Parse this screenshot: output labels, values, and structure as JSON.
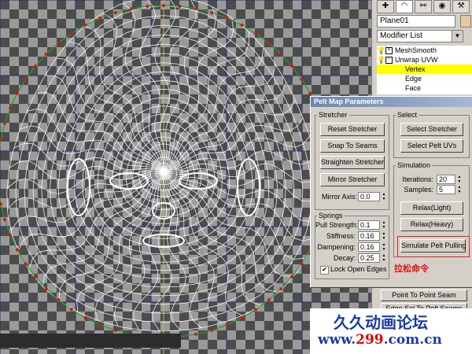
{
  "command_panel": {
    "tabs": [
      "",
      "",
      "",
      "",
      ""
    ],
    "object_name": "Plane01",
    "modifier_list": "Modifier List",
    "stack": [
      {
        "label": "MeshSmooth",
        "expanded": false,
        "selected": false,
        "level": 0
      },
      {
        "label": "Unwrap UVW",
        "expanded": true,
        "selected": false,
        "level": 0
      },
      {
        "label": "Vertex",
        "selected": true,
        "level": 1
      },
      {
        "label": "Edge",
        "selected": false,
        "level": 1
      },
      {
        "label": "Face",
        "selected": false,
        "level": 1
      }
    ]
  },
  "dialog": {
    "title": "Pelt Map Parameters",
    "stretcher": {
      "legend": "Stretcher",
      "reset": "Reset Stretcher",
      "snap": "Snap To Seams",
      "straighten": "Straighten Stretcher",
      "mirror": "Mirror Stretcher",
      "mirror_axis_label": "Mirror Axis:",
      "mirror_axis_value": "0.0"
    },
    "select": {
      "legend": "Select",
      "select_stretcher": "Select Stretcher",
      "select_pelt_uvs": "Select Pelt UVs"
    },
    "simulation": {
      "legend": "Simulation",
      "iterations_label": "Iterations:",
      "iterations_value": "20",
      "samples_label": "Samples:",
      "samples_value": "5",
      "relax_light": "Relax(Light)",
      "relax_heavy": "Relax(Heavy)",
      "simulate": "Simulate Pelt Pulling"
    },
    "springs": {
      "legend": "Springs",
      "pull_label": "Pull Strength:",
      "pull_value": "0.1",
      "stiffness_label": "Stiffness:",
      "stiffness_value": "0.16",
      "dampening_label": "Dampening:",
      "dampening_value": "0.16",
      "decay_label": "Decay:",
      "decay_value": "0.25",
      "lock_open_edges": "Lock Open Edges",
      "lock_checked": true
    }
  },
  "annotation": "拉松命令",
  "lower_buttons": {
    "point_to_point": "Point To Point Seam",
    "edge_sel": "Edge Sel To Pelt Seams"
  },
  "watermark": {
    "line1": "久久动画论坛",
    "line2_prefix": "www.",
    "line2_highlight": "299",
    "line2_suffix": ".com.cn"
  },
  "colors": {
    "selected_row": "#ffff00",
    "mesh": "#ffffff",
    "stretcher_points": "#e01010",
    "stretcher_line": "#20a020",
    "annotation": "#e01010",
    "watermark": "#1a3aa8"
  }
}
